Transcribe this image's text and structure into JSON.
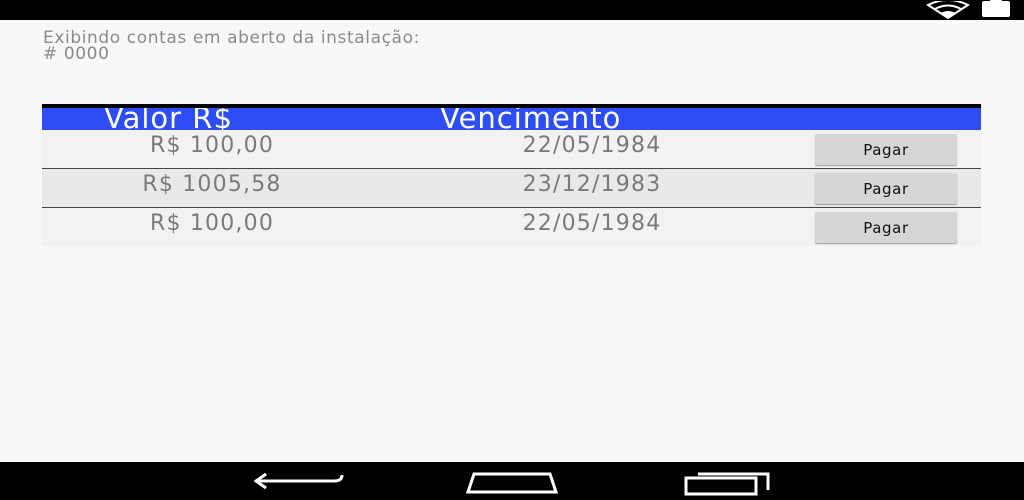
{
  "status_bar": {
    "icons": [
      "wifi-icon",
      "battery-icon"
    ]
  },
  "info": {
    "line1": "Exibindo contas em aberto da instalação:",
    "line2": "# 0000"
  },
  "table": {
    "headers": {
      "valor": "Valor R$",
      "vencimento": "Vencimento",
      "acao": ""
    },
    "rows": [
      {
        "valor": "R$ 100,00",
        "vencimento": "22/05/1984",
        "button": "Pagar"
      },
      {
        "valor": "R$ 1005,58",
        "vencimento": "23/12/1983",
        "button": "Pagar"
      },
      {
        "valor": "R$ 100,00",
        "vencimento": "22/05/1984",
        "button": "Pagar"
      }
    ]
  },
  "nav_bar": {
    "icons": [
      "back-icon",
      "home-icon",
      "recent-apps-icon"
    ]
  },
  "colors": {
    "header_bg": "#2d4ef5",
    "header_text": "#ffffff",
    "row_text": "#7a7a7a",
    "button_bg": "#d6d6d6",
    "system_bars": "#000000"
  }
}
